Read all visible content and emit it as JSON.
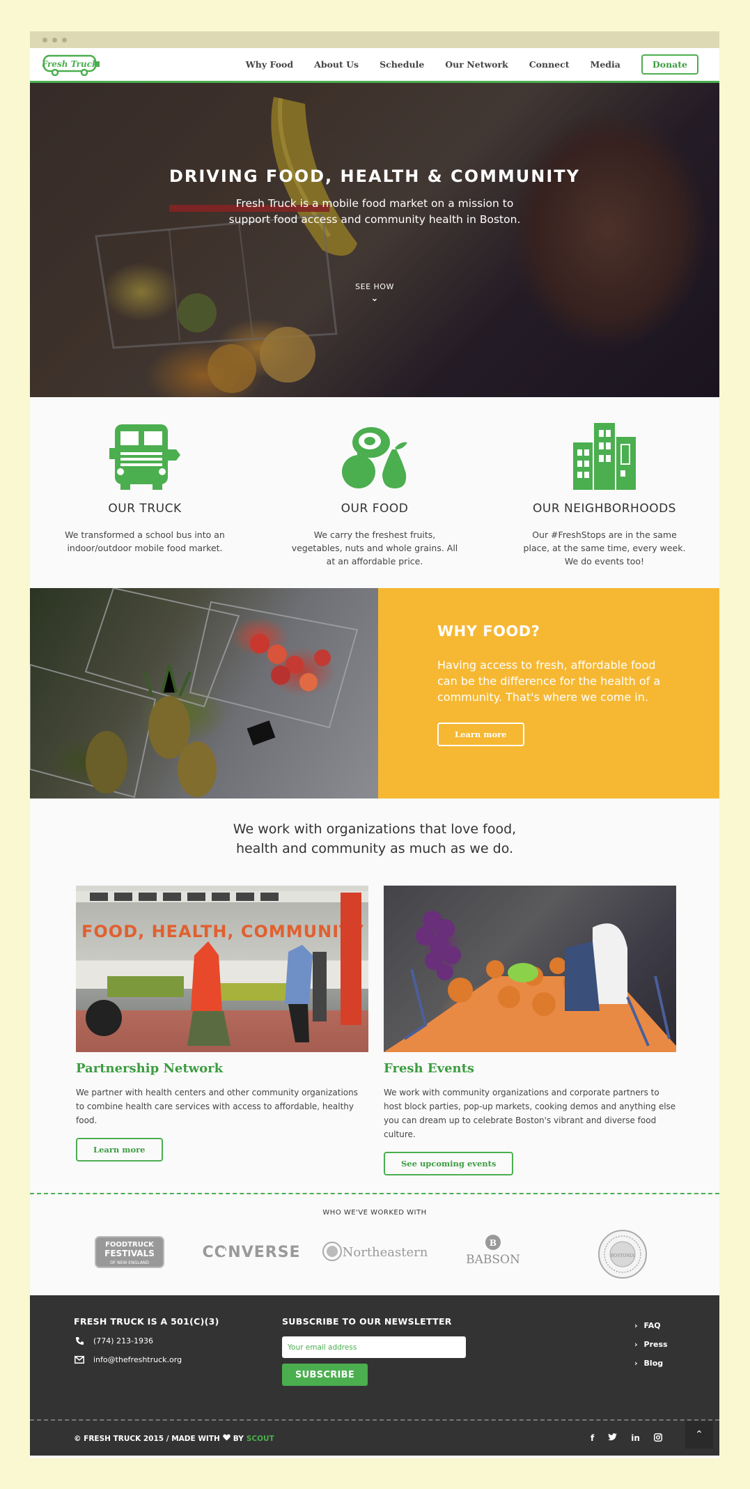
{
  "nav": {
    "logo_text": "Fresh Truck",
    "links": [
      "Why Food",
      "About Us",
      "Schedule",
      "Our Network",
      "Connect",
      "Media"
    ],
    "donate_label": "Donate"
  },
  "hero": {
    "title": "DRIVING FOOD, HEALTH & COMMUNITY",
    "subtitle": "Fresh Truck is a mobile food market on a mission to support food access and community health in Boston.",
    "cta": "SEE HOW",
    "chevron": "⌄"
  },
  "features": [
    {
      "title": "OUR TRUCK",
      "text": "We transformed a school bus into an indoor/outdoor mobile food market."
    },
    {
      "title": "OUR FOOD",
      "text": "We carry the freshest fruits, vegetables, nuts and whole grains. All at an affordable price."
    },
    {
      "title": "OUR NEIGHBORHOODS",
      "text": "Our #FreshStops are in the same place, at the same time, every week. We do events too!"
    }
  ],
  "why": {
    "title": "WHY FOOD?",
    "text": "Having access to fresh, affordable food can be the difference for the health of a community. That's where we come in.",
    "button": "Learn more"
  },
  "orgs": {
    "lead": "We work with organizations that love food, health and community as much as we do.",
    "cards": [
      {
        "image_text": "FOOD, HEALTH, COMMUNITY",
        "title": "Partnership Network",
        "text": "We partner with health centers and other community organizations to combine health care services with access to affordable, healthy food.",
        "button": "Learn more"
      },
      {
        "title": "Fresh Events",
        "text": "We work with community organizations and corporate partners to host block parties, pop-up markets, cooking demos and anything else you can dream up to celebrate Boston's vibrant and diverse food culture.",
        "button": "See upcoming events"
      }
    ]
  },
  "partners": {
    "label": "WHO WE'VE WORKED WITH",
    "logos": [
      {
        "name": "foodtruck-festivals",
        "lines": [
          "FOODTRUCK",
          "FESTIVALS",
          "OF NEW ENGLAND"
        ]
      },
      {
        "name": "converse",
        "text": "CONVERSE"
      },
      {
        "name": "northeastern",
        "text": "Northeastern"
      },
      {
        "name": "babson",
        "text": "BABSON"
      },
      {
        "name": "city-seal",
        "text": "BOSTONIA"
      }
    ]
  },
  "footer": {
    "col1_title": "FRESH TRUCK IS A 501(C)(3)",
    "phone": "(774) 213-1936",
    "email": "info@thefreshtruck.org",
    "newsletter_title": "SUBSCRIBE TO OUR NEWSLETTER",
    "email_placeholder": "Your email address",
    "subscribe_label": "SUBSCRIBE",
    "links": [
      "FAQ",
      "Press",
      "Blog"
    ],
    "copyright_prefix": "© FRESH TRUCK 2015  /  MADE WITH",
    "copyright_by": "BY",
    "copyright_scout": "SCOUT",
    "socials": [
      "f",
      "t",
      "in",
      "ig"
    ],
    "to_top": "⌃"
  },
  "colors": {
    "green": "#4bae4f",
    "yellow": "#f6b833",
    "dark": "#333333",
    "page_bg": "#f9f8d0"
  }
}
